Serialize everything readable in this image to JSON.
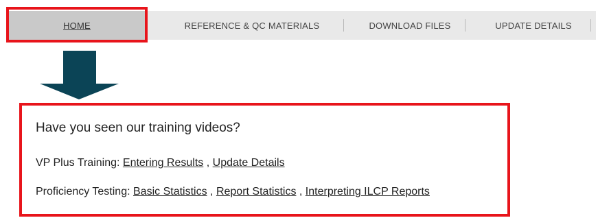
{
  "nav": {
    "items": [
      {
        "label": "HOME"
      },
      {
        "label": "REFERENCE & QC MATERIALS"
      },
      {
        "label": "DOWNLOAD FILES"
      },
      {
        "label": "UPDATE DETAILS"
      }
    ]
  },
  "panel": {
    "heading": "Have you seen our training videos?",
    "vp_plus": {
      "prefix": "VP Plus Training:",
      "links": [
        "Entering Results",
        "Update Details"
      ],
      "separator": ","
    },
    "proficiency": {
      "prefix": "Proficiency Testing:",
      "links": [
        "Basic Statistics",
        "Report Statistics",
        "Interpreting ILCP Reports"
      ],
      "separator": ","
    }
  },
  "colors": {
    "highlight": "#e8141b",
    "arrow": "#0b4456",
    "nav_background": "#e9e9e9",
    "nav_active": "#c9c9c9"
  },
  "icons": {
    "arrow": "down-arrow-icon"
  }
}
